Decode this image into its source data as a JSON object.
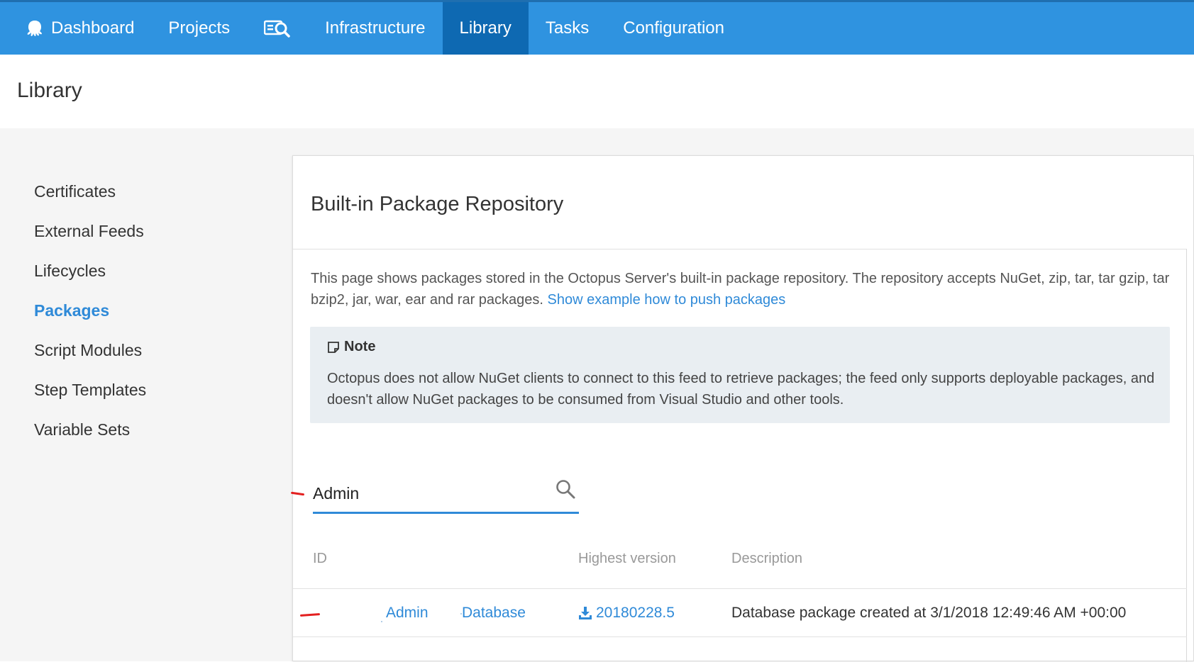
{
  "nav": {
    "dashboard": "Dashboard",
    "projects": "Projects",
    "infrastructure": "Infrastructure",
    "library": "Library",
    "tasks": "Tasks",
    "configuration": "Configuration",
    "active": "Library"
  },
  "page": {
    "title": "Library"
  },
  "sidebar": {
    "items": [
      {
        "label": "Certificates"
      },
      {
        "label": "External Feeds"
      },
      {
        "label": "Lifecycles"
      },
      {
        "label": "Packages",
        "active": true
      },
      {
        "label": "Script Modules"
      },
      {
        "label": "Step Templates"
      },
      {
        "label": "Variable Sets"
      }
    ]
  },
  "panel": {
    "title": "Built-in Package Repository",
    "intro": "This page shows packages stored in the Octopus Server's built-in package repository. The repository accepts NuGet, zip, tar, tar gzip, tar bzip2, jar, war, ear and rar packages.",
    "intro_link": "Show example how to push packages",
    "note": {
      "title": "Note",
      "body": "Octopus does not allow NuGet clients to connect to this feed to retrieve packages; the feed only supports deployable packages, and doesn't allow NuGet packages to be consumed from Visual Studio and other tools."
    },
    "search": {
      "value": "Admin"
    },
    "table": {
      "headers": {
        "id": "ID",
        "version": "Highest version",
        "description": "Description"
      },
      "rows": [
        {
          "id_part1": "Admin",
          "id_part2": "Database",
          "version": "20180228.5",
          "description": "Database package created at 3/1/2018 12:49:46 AM +00:00"
        }
      ]
    }
  },
  "colors": {
    "nav_bg": "#2f93e0",
    "nav_active": "#0e69b2",
    "link": "#2f8ad8",
    "annotation": "#e32020"
  },
  "icons": {
    "logo": "octopus-icon",
    "nav_search": "search-list-icon",
    "note": "note-icon",
    "search": "search-icon",
    "download": "download-icon"
  }
}
